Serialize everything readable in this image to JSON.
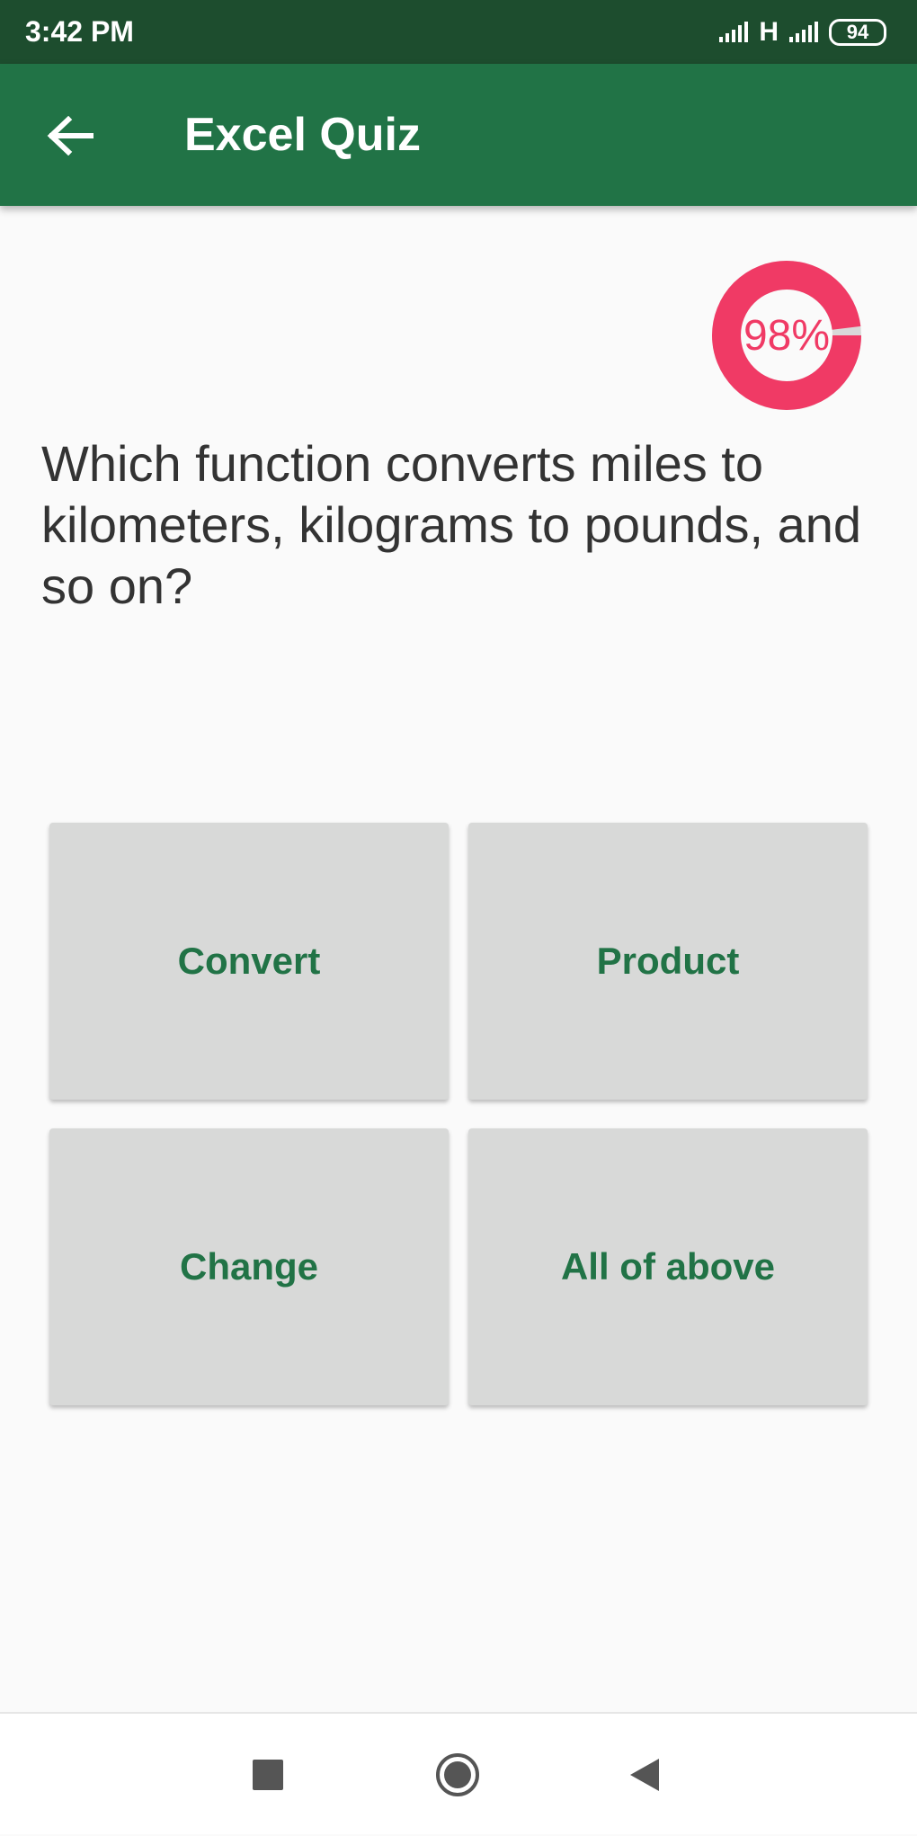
{
  "status_bar": {
    "time": "3:42 PM",
    "network": "H",
    "battery": "94"
  },
  "app_bar": {
    "title": "Excel Quiz",
    "back_icon": "arrow-left-icon"
  },
  "progress": {
    "text": "98%",
    "fraction": 0.98,
    "color": "#f03a65",
    "track_color": "#d9d9d9"
  },
  "question": {
    "text": "Which function converts miles to kilometers, kilograms to pounds, and so on?"
  },
  "answers": [
    {
      "label": "Convert"
    },
    {
      "label": "Product"
    },
    {
      "label": "Change"
    },
    {
      "label": "All of above"
    }
  ],
  "nav_bar": {
    "recents_icon": "square-icon",
    "home_icon": "circle-icon",
    "back_icon": "triangle-back-icon"
  },
  "colors": {
    "status_bar": "#1d4d2e",
    "app_bar": "#217346",
    "answer_bg": "#d8d9d8",
    "answer_text": "#217346"
  }
}
